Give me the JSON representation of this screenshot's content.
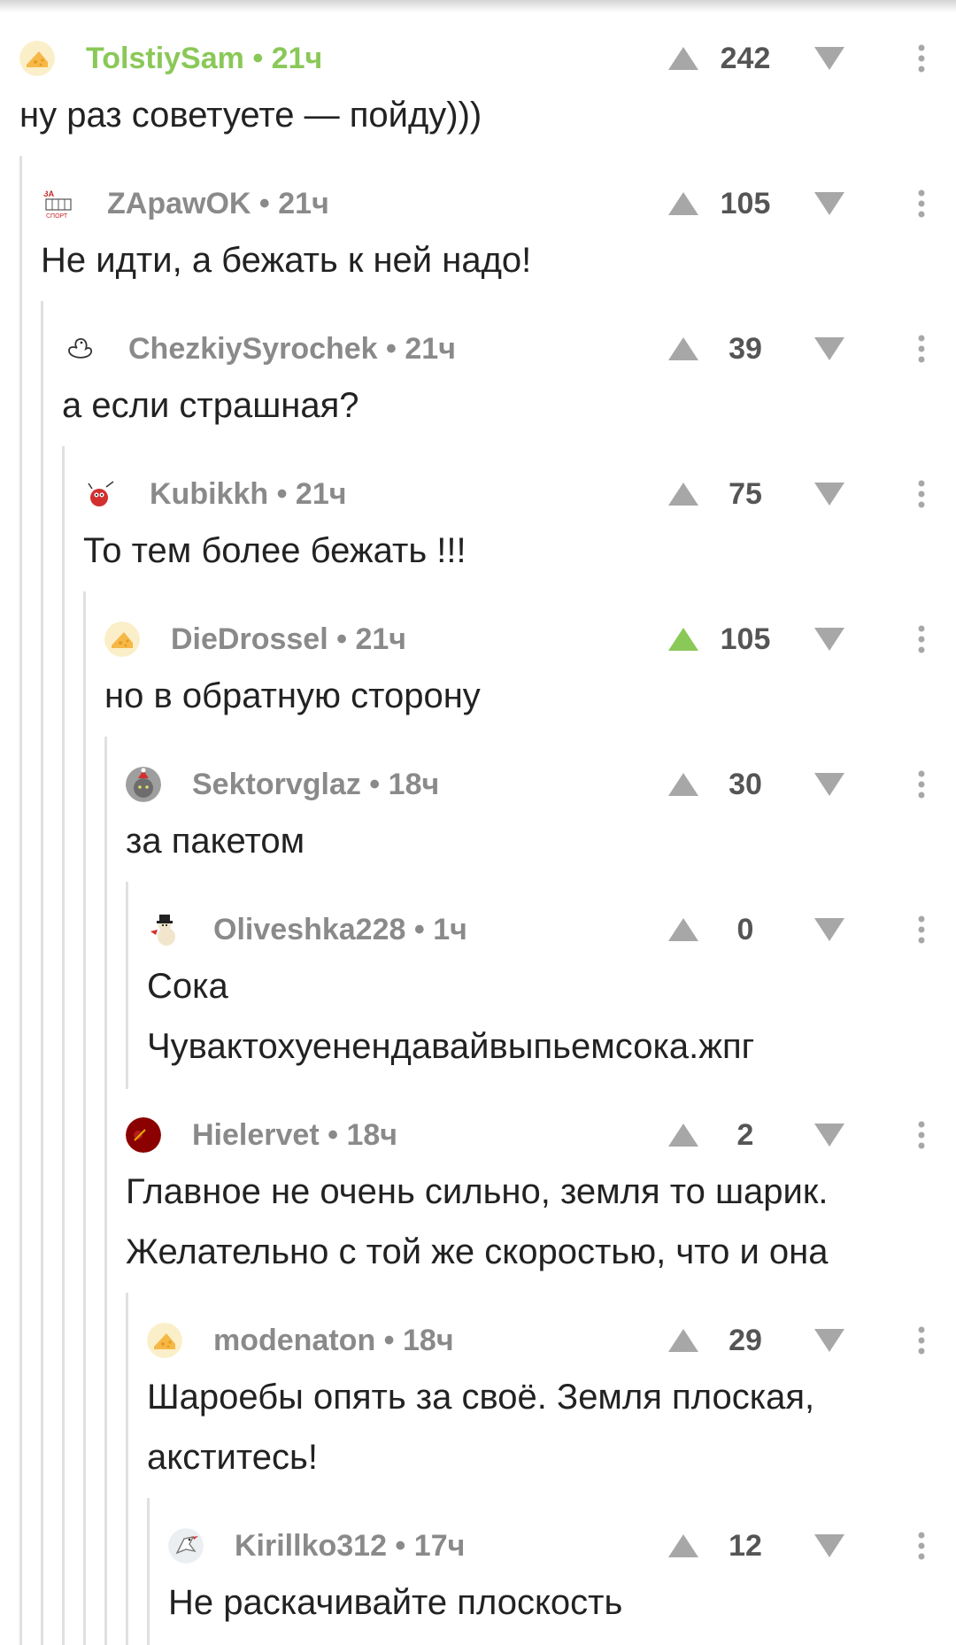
{
  "colors": {
    "author": "#8a8a8a",
    "author_op": "#8ac858",
    "vote_arrow": "#a7a7a7",
    "vote_up_active": "#8ac858",
    "thread_line": "#e0e0e0"
  },
  "comments": [
    {
      "author": "TolstiySam",
      "time": "21ч",
      "votes": "242",
      "avatar": "cheese-avatar",
      "lines": [
        "ну раз советуете — пойду)))"
      ],
      "highlight_author": true,
      "upvoted": false
    },
    {
      "author": "ZApawOK",
      "time": "21ч",
      "votes": "105",
      "avatar": "za-sport-avatar",
      "lines": [
        "Не идти, а бежать к ней надо!"
      ],
      "highlight_author": false,
      "upvoted": false
    },
    {
      "author": "ChezkiySyrochek",
      "time": "21ч",
      "votes": "39",
      "avatar": "duck-outline-avatar",
      "lines": [
        "а если страшная?"
      ],
      "highlight_author": false,
      "upvoted": false
    },
    {
      "author": "Kubikkh",
      "time": "21ч",
      "votes": "75",
      "avatar": "red-bug-avatar",
      "lines": [
        "То тем более бежать !!!"
      ],
      "highlight_author": false,
      "upvoted": false
    },
    {
      "author": "DieDrossel",
      "time": "21ч",
      "votes": "105",
      "avatar": "cheese-avatar",
      "lines": [
        "но в обратную сторону"
      ],
      "highlight_author": false,
      "upvoted": true
    },
    {
      "author": "Sektorvglaz",
      "time": "18ч",
      "votes": "30",
      "avatar": "cat-santa-avatar",
      "lines": [
        "за пакетом"
      ],
      "highlight_author": false,
      "upvoted": false
    },
    {
      "author": "Oliveshka228",
      "time": "1ч",
      "votes": "0",
      "avatar": "snowman-avatar",
      "lines": [
        "Сока",
        "Чувактохуенендавайвыпьемсока.жпг"
      ],
      "highlight_author": false,
      "upvoted": false
    },
    {
      "author": "Hielervet",
      "time": "18ч",
      "votes": "2",
      "avatar": "dark-red-avatar",
      "lines": [
        "Главное не очень сильно, земля то шарик.",
        "Желательно с той же скоростью, что и она"
      ],
      "highlight_author": false,
      "upvoted": false
    },
    {
      "author": "modenaton",
      "time": "18ч",
      "votes": "29",
      "avatar": "cheese-avatar",
      "lines": [
        "Шароебы опять за своё. Земля плоская,",
        "акститесь!"
      ],
      "highlight_author": false,
      "upvoted": false
    },
    {
      "author": "Kirillko312",
      "time": "17ч",
      "votes": "12",
      "avatar": "bird-avatar",
      "lines": [
        "Не раскачивайте плоскость"
      ],
      "highlight_author": false,
      "upvoted": false
    }
  ]
}
